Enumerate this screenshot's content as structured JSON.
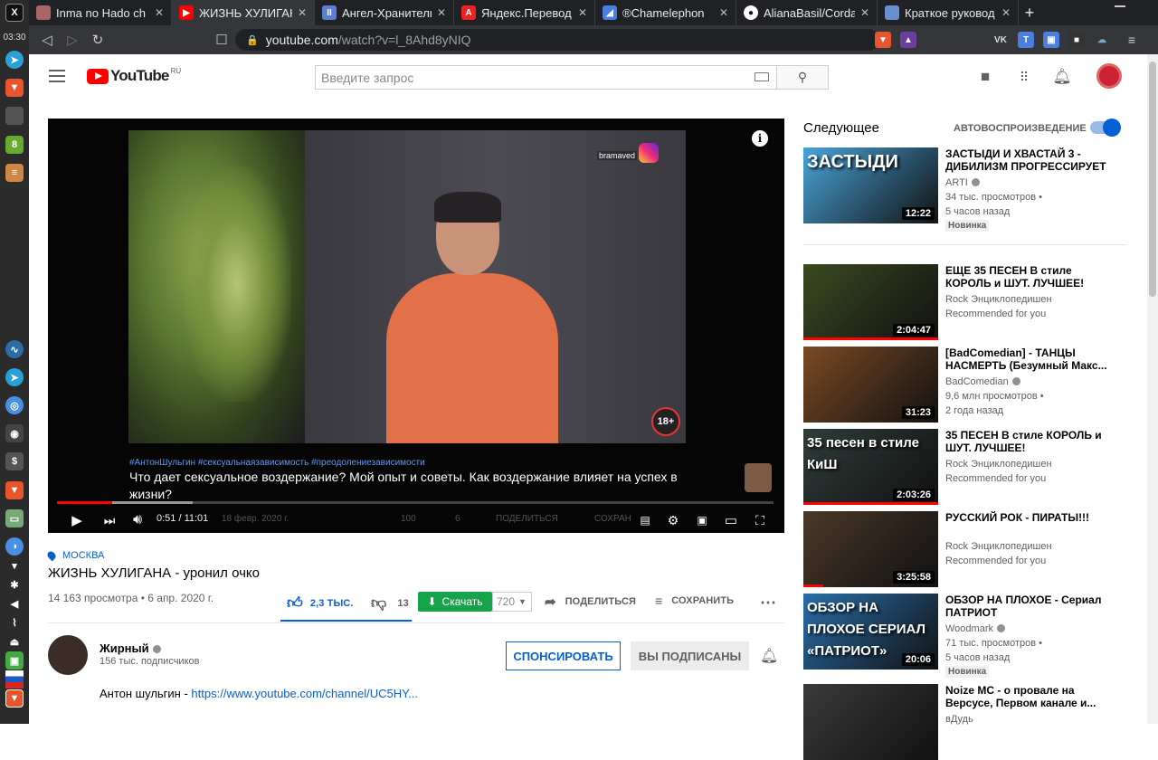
{
  "dock": {
    "clock": "03:30"
  },
  "tabs": [
    {
      "title": "Inma no Hado ch",
      "favicon_color": "#a66"
    },
    {
      "title": "ЖИЗНЬ ХУЛИГАН",
      "favicon_color": "#f00",
      "active": true
    },
    {
      "title": "Ангел-Хранитель",
      "favicon_color": "#5c7fd6"
    },
    {
      "title": "Яндекс.Перевод",
      "favicon_color": "#e22"
    },
    {
      "title": "®Chamelephon",
      "favicon_color": "#4a7fe0"
    },
    {
      "title": "AlianaBasil/Corda",
      "favicon_color": "#fff"
    },
    {
      "title": "Краткое руковод",
      "favicon_color": "#6a8fd0"
    }
  ],
  "address": {
    "host": "youtube.com",
    "path": "/watch?v=l_8Ahd8yNIQ"
  },
  "header": {
    "logo_text": "YouTube",
    "region": "RU",
    "search_placeholder": "Введите запрос"
  },
  "player": {
    "hashtags": "#АнтонШульгин #сексуальнаязависимость #преодолениезависимости",
    "subtitle": "Что дает сексуальное воздержание? Мой опыт и советы. Как воздержание влияет на успех в жизни?",
    "watermark": "bramaved",
    "age_badge": "18+",
    "time": "0:51 / 11:01",
    "progress": 0.077,
    "ghost_date": "18 февр. 2020 г.",
    "ghost_likes": "100",
    "ghost_dislikes": "6",
    "ghost_share": "ПОДЕЛИТЬСЯ",
    "ghost_save": "СОХРАН"
  },
  "video": {
    "location": "МОСКВА",
    "title": "ЖИЗНЬ ХУЛИГАНА - уронил очко",
    "views_date": "14 163 просмотра • 6 апр. 2020 г.",
    "likes": "2,3 ТЫС.",
    "dislikes": "13",
    "like_ratio": 0.994,
    "download_label": "Скачать",
    "quality": "720",
    "share_label": "ПОДЕЛИТЬСЯ",
    "save_label": "СОХРАНИТЬ"
  },
  "channel": {
    "name": "Жирный",
    "subscribers": "156 тыс. подписчиков",
    "sponsor_label": "СПОНСИРОВАТЬ",
    "subscribed_label": "ВЫ ПОДПИСАНЫ",
    "description_prefix": "Антон шульгин - ",
    "description_link": "https://www.youtube.com/channel/UC5HY..."
  },
  "sidebar": {
    "up_next": "Следующее",
    "autoplay": "АВТОВОСПРОИЗВЕДЕНИЕ",
    "videos": [
      {
        "title": "ЗАСТЫДИ И ХВАСТАЙ 3 - ДИБИЛИЗМ ПРОГРЕССИРУЕТ",
        "channel": "ARTI",
        "verified": true,
        "line2": "34 тыс. просмотров •",
        "line3": "5 часов назад",
        "badge": "Новинка",
        "duration": "12:22",
        "overlay": "ЗАСТЫДИ",
        "thumb_color": "#4aa3d9"
      },
      {
        "title": "ЕЩЕ 35 ПЕСЕН В стиле КОРОЛЬ и ШУТ. ЛУЧШЕЕ!",
        "channel": "Rock Энциклопедишен",
        "verified": false,
        "line2": "Recommended for you",
        "line3": "",
        "badge": "",
        "duration": "2:04:47",
        "overlay": "",
        "thumb_color": "#3a4a20",
        "progress": 1.0
      },
      {
        "title": "[BadComedian] - ТАНЦЫ НАСМЕРТЬ (Безумный Макс...",
        "channel": "BadComedian",
        "verified": true,
        "line2": "9,6 млн просмотров •",
        "line3": "2 года назад",
        "badge": "",
        "duration": "31:23",
        "overlay": "",
        "thumb_color": "#7a4a22"
      },
      {
        "title": "35 ПЕСЕН В стиле КОРОЛЬ и ШУТ. ЛУЧШЕЕ!",
        "channel": "Rock Энциклопедишен",
        "verified": false,
        "line2": "Recommended for you",
        "line3": "",
        "badge": "",
        "duration": "2:03:26",
        "overlay": "35 песен в стиле КиШ",
        "thumb_color": "#2f3d3a",
        "progress": 1.0
      },
      {
        "title": "РУССКИЙ РОК - ПИРАТЫ!!!",
        "channel": "Rock Энциклопедишен",
        "verified": false,
        "line2": "Recommended for you",
        "line3": "",
        "badge": "",
        "duration": "3:25:58",
        "overlay": "",
        "thumb_color": "#4a3828",
        "progress": 0.15
      },
      {
        "title": "ОБЗОР НА ПЛОХОЕ - Сериал ПАТРИОТ",
        "channel": "Woodmark",
        "verified": true,
        "line2": "71 тыс. просмотров •",
        "line3": "5 часов назад",
        "badge": "Новинка",
        "duration": "20:06",
        "overlay": "ОБЗОР НА ПЛОХОЕ СЕРИАЛ «ПАТРИОТ»",
        "thumb_color": "#2a6ea8"
      },
      {
        "title": "Noize MC - о провале на Версусе, Первом канале и...",
        "channel": "вДудь",
        "verified": false,
        "line2": "",
        "line3": "",
        "badge": "",
        "duration": "",
        "overlay": "",
        "thumb_color": "#3a3a3a"
      }
    ]
  }
}
